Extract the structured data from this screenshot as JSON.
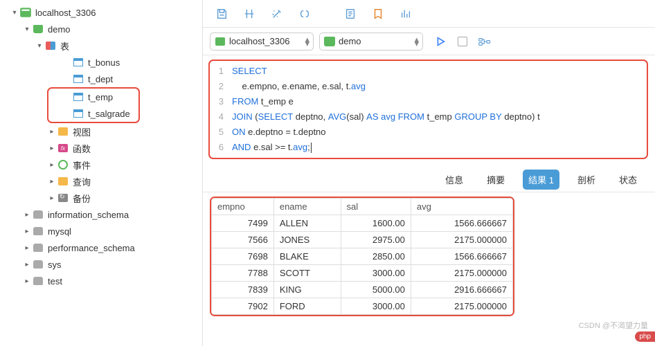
{
  "sidebar": {
    "connection": "localhost_3306",
    "databases": [
      {
        "name": "demo",
        "expanded": true,
        "tables_label": "表",
        "tables": [
          "t_bonus",
          "t_dept",
          "t_emp",
          "t_salgrade"
        ],
        "sections": {
          "views": "视图",
          "functions": "函数",
          "events": "事件",
          "queries": "查询",
          "backups": "备份"
        }
      },
      {
        "name": "information_schema"
      },
      {
        "name": "mysql"
      },
      {
        "name": "performance_schema"
      },
      {
        "name": "sys"
      },
      {
        "name": "test"
      }
    ]
  },
  "toolbar": {
    "selector_connection": "localhost_3306",
    "selector_database": "demo"
  },
  "editor": {
    "lines": [
      {
        "n": "1",
        "tokens": [
          [
            "kw",
            "SELECT"
          ]
        ]
      },
      {
        "n": "2",
        "tokens": [
          [
            "ident",
            "    e.empno, e.ename, e.sal, t."
          ],
          [
            "kw",
            "avg"
          ]
        ]
      },
      {
        "n": "3",
        "tokens": [
          [
            "kw",
            "FROM"
          ],
          [
            "ident",
            " t_emp e"
          ]
        ]
      },
      {
        "n": "4",
        "tokens": [
          [
            "kw",
            "JOIN"
          ],
          [
            "ident",
            " ("
          ],
          [
            "kw",
            "SELECT"
          ],
          [
            "ident",
            " deptno, "
          ],
          [
            "kw",
            "AVG"
          ],
          [
            "ident",
            "(sal) "
          ],
          [
            "kw",
            "AS"
          ],
          [
            "ident",
            " "
          ],
          [
            "kw",
            "avg"
          ],
          [
            "ident",
            " "
          ],
          [
            "kw",
            "FROM"
          ],
          [
            "ident",
            " t_emp "
          ],
          [
            "kw",
            "GROUP BY"
          ],
          [
            "ident",
            " deptno) t"
          ]
        ]
      },
      {
        "n": "5",
        "tokens": [
          [
            "kw",
            "ON"
          ],
          [
            "ident",
            " e.deptno = t.deptno"
          ]
        ]
      },
      {
        "n": "6",
        "tokens": [
          [
            "kw",
            "AND"
          ],
          [
            "ident",
            " e.sal >= t."
          ],
          [
            "kw",
            "avg"
          ],
          [
            "ident",
            ";"
          ]
        ]
      }
    ]
  },
  "tabs": {
    "info": "信息",
    "summary": "摘要",
    "result": "结果 1",
    "profile": "剖析",
    "status": "状态"
  },
  "results": {
    "columns": [
      "empno",
      "ename",
      "sal",
      "avg"
    ],
    "rows": [
      [
        "7499",
        "ALLEN",
        "1600.00",
        "1566.666667"
      ],
      [
        "7566",
        "JONES",
        "2975.00",
        "2175.000000"
      ],
      [
        "7698",
        "BLAKE",
        "2850.00",
        "1566.666667"
      ],
      [
        "7788",
        "SCOTT",
        "3000.00",
        "2175.000000"
      ],
      [
        "7839",
        "KING",
        "5000.00",
        "2916.666667"
      ],
      [
        "7902",
        "FORD",
        "3000.00",
        "2175.000000"
      ]
    ]
  },
  "watermark": "CSDN @不渴望力量",
  "php_badge": "php"
}
